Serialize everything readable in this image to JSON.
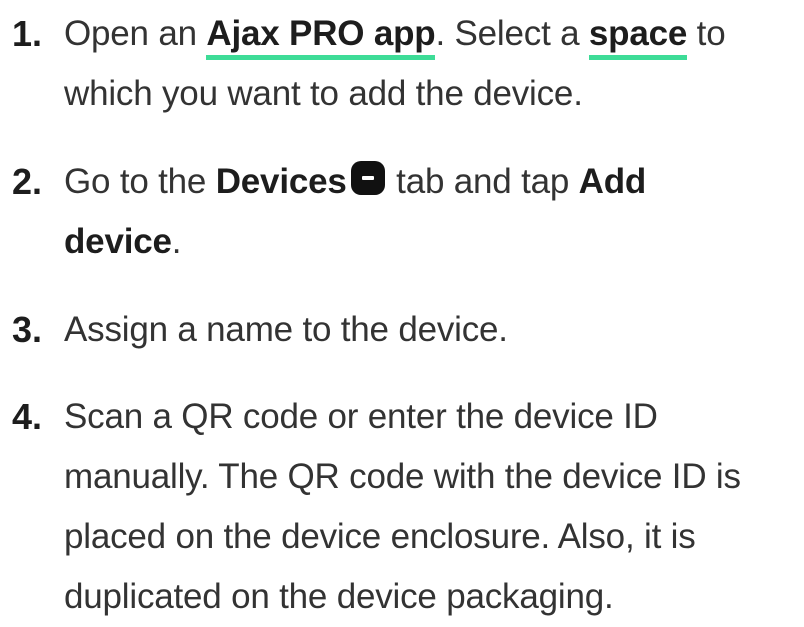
{
  "steps": [
    {
      "number": "1.",
      "text_1": "Open an ",
      "link_1": "Ajax PRO app",
      "text_2": ". Select a ",
      "link_2": "space",
      "text_3": " to",
      "line_2": "which you want to add the device."
    },
    {
      "number": "2.",
      "text_1": "Go to the ",
      "bold_1": "Devices",
      "icon": "devices-tab-icon",
      "text_2": " tab and tap ",
      "bold_2": "Add",
      "bold_3": "device",
      "text_3": "."
    },
    {
      "number": "3.",
      "text_1": "Assign a name to the device."
    },
    {
      "number": "4.",
      "line_1": "Scan a QR code or enter the device ID",
      "line_2": "manually. The QR code with the device ID is",
      "line_3": "placed on the device enclosure. Also, it is",
      "line_4": "duplicated on the device packaging."
    }
  ],
  "colors": {
    "text": "#333333",
    "bold_text": "#1d1d1d",
    "link_underline": "#3ddc97",
    "icon": "#111111"
  }
}
